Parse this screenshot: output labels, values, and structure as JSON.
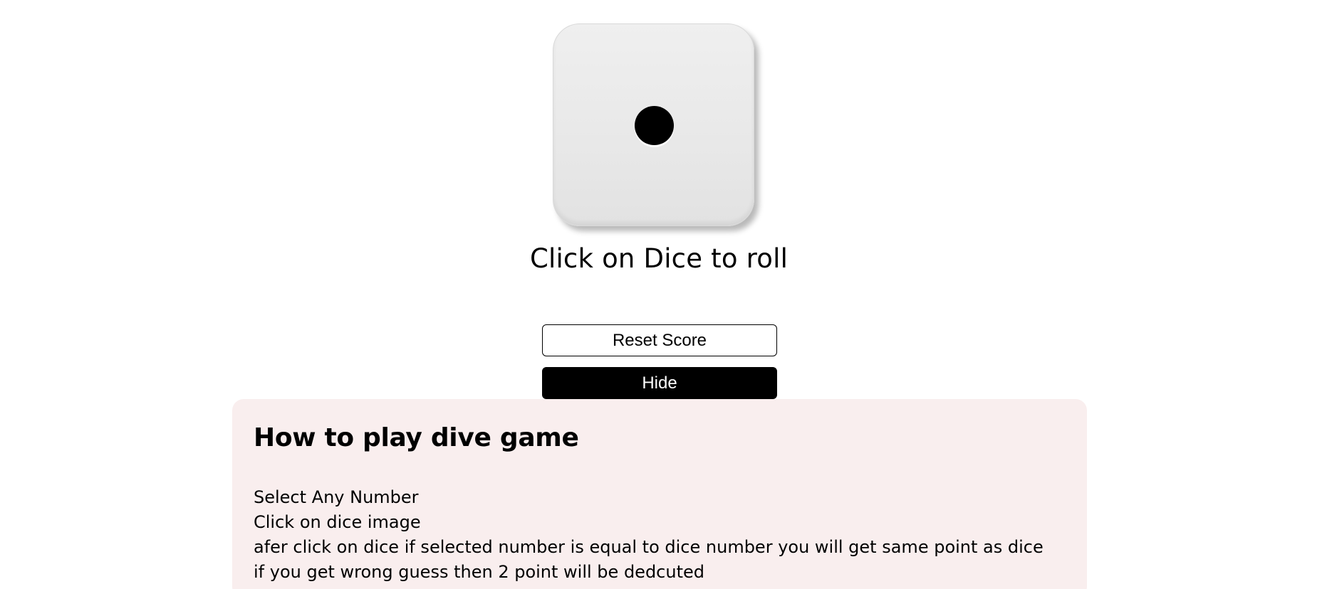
{
  "dice": {
    "value": 1,
    "icon": "dice-one-icon"
  },
  "instruction": "Click on Dice to roll",
  "buttons": {
    "reset_label": "Reset Score",
    "hide_label": "Hide"
  },
  "rules": {
    "title": "How to play dive game",
    "items": [
      "Select Any Number",
      "Click on dice image",
      "afer click on dice if selected number is equal to dice number you will get same point as dice",
      "if you get wrong guess then 2 point will be dedcuted"
    ]
  },
  "colors": {
    "background": "#ffffff",
    "rules_panel": "#f9eeee",
    "primary": "#000000"
  }
}
